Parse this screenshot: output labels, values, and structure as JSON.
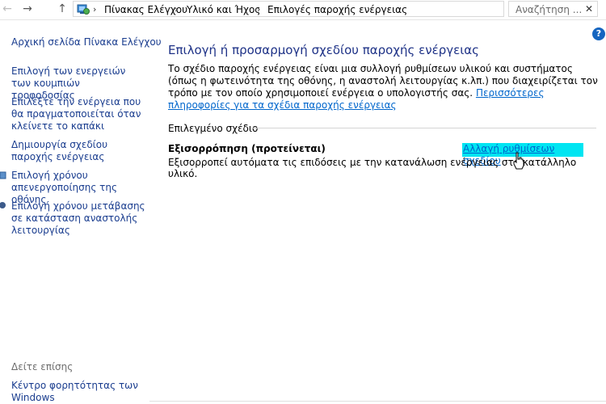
{
  "nav": {
    "back_icon": "back-arrow-icon",
    "forward_icon": "forward-arrow-icon",
    "up_icon": "up-arrow-icon"
  },
  "breadcrumb": [
    "Πίνακας Ελέγχου",
    "Υλικό και Ήχος",
    "Επιλογές παροχής ενέργειας"
  ],
  "search": {
    "placeholder": "Αναζήτηση ..."
  },
  "sidebar": {
    "home": "Αρχική σελίδα Πίνακα Ελέγχου",
    "items": [
      "Επιλογή των ενεργειών των κουμπιών τροφοδοσίας",
      "Επιλέξτε την ενέργεια που θα πραγματοποιείται όταν κλείνετε το καπάκι",
      "Δημιουργία σχεδίου παροχής ενέργειας",
      "Επιλογή χρόνου απενεργοποίησης της οθόνης",
      "Επιλογή χρόνου μετάβασης σε κατάσταση αναστολής λειτουργίας"
    ],
    "see_also": "Δείτε επίσης",
    "see_also_items": [
      "Κέντρο φορητότητας των Windows"
    ]
  },
  "main": {
    "title": "Επιλογή ή προσαρμογή σχεδίου παροχής ενέργειας",
    "description": "Το σχέδιο παροχής ενέργειας είναι μια συλλογή ρυθμίσεων υλικού και συστήματος (όπως η φωτεινότητα της οθόνης, η αναστολή λειτουργίας κ.λπ.) που διαχειρίζεται τον τρόπο με τον οποίο χρησιμοποιεί ενέργεια ο υπολογιστής σας.",
    "more_info_link": "Περισσότερες πληροφορίες για τα σχέδια παροχής ενέργειας",
    "section_label": "Επιλεγμένο σχέδιο",
    "plan_name": "Εξισορρόπηση (προτείνεται)",
    "change_link": "Αλλαγή ρυθμίσεων σχεδίου",
    "plan_description": "Εξισορροπεί αυτόματα τις επιδόσεις με την κατανάλωση ενέργειας στο κατάλληλο υλικό."
  },
  "colors": {
    "link": "#0066cc",
    "title": "#1e3287",
    "highlight": "#00e5f2",
    "sidebar_link": "#1a3d8f"
  }
}
